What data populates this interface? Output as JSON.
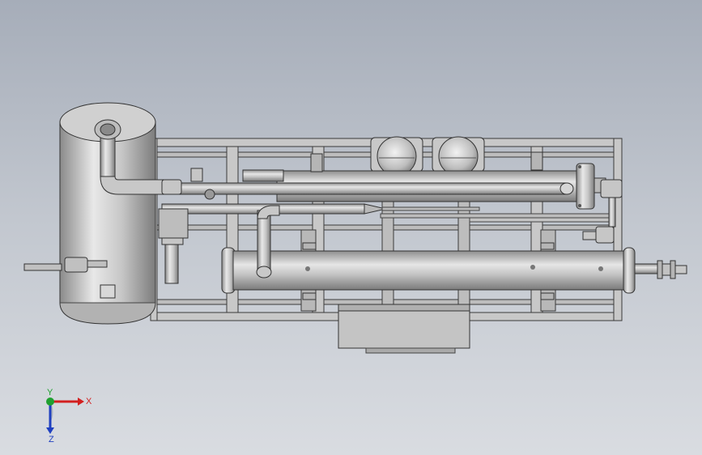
{
  "viewport": {
    "background_top": "#a6adb9",
    "background_bottom": "#d9dce1",
    "model_color": "#c9c9c9",
    "edge_color": "#3a3a3a"
  },
  "triad": {
    "x_label": "X",
    "y_label": "Y",
    "z_label": "Z",
    "x_color": "#d22020",
    "y_color": "#20a030",
    "z_color": "#2040c0"
  }
}
